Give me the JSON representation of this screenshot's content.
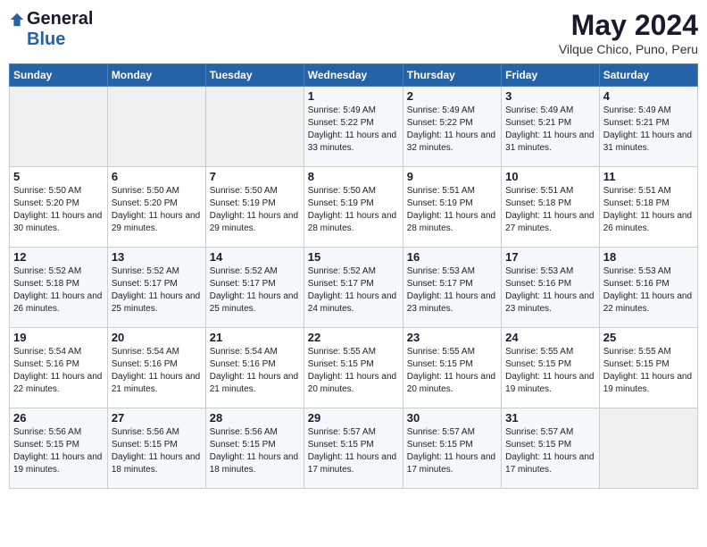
{
  "logo": {
    "general": "General",
    "blue": "Blue"
  },
  "title": "May 2024",
  "subtitle": "Vilque Chico, Puno, Peru",
  "days_of_week": [
    "Sunday",
    "Monday",
    "Tuesday",
    "Wednesday",
    "Thursday",
    "Friday",
    "Saturday"
  ],
  "weeks": [
    [
      {
        "day": "",
        "info": ""
      },
      {
        "day": "",
        "info": ""
      },
      {
        "day": "",
        "info": ""
      },
      {
        "day": "1",
        "info": "Sunrise: 5:49 AM\nSunset: 5:22 PM\nDaylight: 11 hours\nand 33 minutes."
      },
      {
        "day": "2",
        "info": "Sunrise: 5:49 AM\nSunset: 5:22 PM\nDaylight: 11 hours\nand 32 minutes."
      },
      {
        "day": "3",
        "info": "Sunrise: 5:49 AM\nSunset: 5:21 PM\nDaylight: 11 hours\nand 31 minutes."
      },
      {
        "day": "4",
        "info": "Sunrise: 5:49 AM\nSunset: 5:21 PM\nDaylight: 11 hours\nand 31 minutes."
      }
    ],
    [
      {
        "day": "5",
        "info": "Sunrise: 5:50 AM\nSunset: 5:20 PM\nDaylight: 11 hours\nand 30 minutes."
      },
      {
        "day": "6",
        "info": "Sunrise: 5:50 AM\nSunset: 5:20 PM\nDaylight: 11 hours\nand 29 minutes."
      },
      {
        "day": "7",
        "info": "Sunrise: 5:50 AM\nSunset: 5:19 PM\nDaylight: 11 hours\nand 29 minutes."
      },
      {
        "day": "8",
        "info": "Sunrise: 5:50 AM\nSunset: 5:19 PM\nDaylight: 11 hours\nand 28 minutes."
      },
      {
        "day": "9",
        "info": "Sunrise: 5:51 AM\nSunset: 5:19 PM\nDaylight: 11 hours\nand 28 minutes."
      },
      {
        "day": "10",
        "info": "Sunrise: 5:51 AM\nSunset: 5:18 PM\nDaylight: 11 hours\nand 27 minutes."
      },
      {
        "day": "11",
        "info": "Sunrise: 5:51 AM\nSunset: 5:18 PM\nDaylight: 11 hours\nand 26 minutes."
      }
    ],
    [
      {
        "day": "12",
        "info": "Sunrise: 5:52 AM\nSunset: 5:18 PM\nDaylight: 11 hours\nand 26 minutes."
      },
      {
        "day": "13",
        "info": "Sunrise: 5:52 AM\nSunset: 5:17 PM\nDaylight: 11 hours\nand 25 minutes."
      },
      {
        "day": "14",
        "info": "Sunrise: 5:52 AM\nSunset: 5:17 PM\nDaylight: 11 hours\nand 25 minutes."
      },
      {
        "day": "15",
        "info": "Sunrise: 5:52 AM\nSunset: 5:17 PM\nDaylight: 11 hours\nand 24 minutes."
      },
      {
        "day": "16",
        "info": "Sunrise: 5:53 AM\nSunset: 5:17 PM\nDaylight: 11 hours\nand 23 minutes."
      },
      {
        "day": "17",
        "info": "Sunrise: 5:53 AM\nSunset: 5:16 PM\nDaylight: 11 hours\nand 23 minutes."
      },
      {
        "day": "18",
        "info": "Sunrise: 5:53 AM\nSunset: 5:16 PM\nDaylight: 11 hours\nand 22 minutes."
      }
    ],
    [
      {
        "day": "19",
        "info": "Sunrise: 5:54 AM\nSunset: 5:16 PM\nDaylight: 11 hours\nand 22 minutes."
      },
      {
        "day": "20",
        "info": "Sunrise: 5:54 AM\nSunset: 5:16 PM\nDaylight: 11 hours\nand 21 minutes."
      },
      {
        "day": "21",
        "info": "Sunrise: 5:54 AM\nSunset: 5:16 PM\nDaylight: 11 hours\nand 21 minutes."
      },
      {
        "day": "22",
        "info": "Sunrise: 5:55 AM\nSunset: 5:15 PM\nDaylight: 11 hours\nand 20 minutes."
      },
      {
        "day": "23",
        "info": "Sunrise: 5:55 AM\nSunset: 5:15 PM\nDaylight: 11 hours\nand 20 minutes."
      },
      {
        "day": "24",
        "info": "Sunrise: 5:55 AM\nSunset: 5:15 PM\nDaylight: 11 hours\nand 19 minutes."
      },
      {
        "day": "25",
        "info": "Sunrise: 5:55 AM\nSunset: 5:15 PM\nDaylight: 11 hours\nand 19 minutes."
      }
    ],
    [
      {
        "day": "26",
        "info": "Sunrise: 5:56 AM\nSunset: 5:15 PM\nDaylight: 11 hours\nand 19 minutes."
      },
      {
        "day": "27",
        "info": "Sunrise: 5:56 AM\nSunset: 5:15 PM\nDaylight: 11 hours\nand 18 minutes."
      },
      {
        "day": "28",
        "info": "Sunrise: 5:56 AM\nSunset: 5:15 PM\nDaylight: 11 hours\nand 18 minutes."
      },
      {
        "day": "29",
        "info": "Sunrise: 5:57 AM\nSunset: 5:15 PM\nDaylight: 11 hours\nand 17 minutes."
      },
      {
        "day": "30",
        "info": "Sunrise: 5:57 AM\nSunset: 5:15 PM\nDaylight: 11 hours\nand 17 minutes."
      },
      {
        "day": "31",
        "info": "Sunrise: 5:57 AM\nSunset: 5:15 PM\nDaylight: 11 hours\nand 17 minutes."
      },
      {
        "day": "",
        "info": ""
      }
    ]
  ]
}
